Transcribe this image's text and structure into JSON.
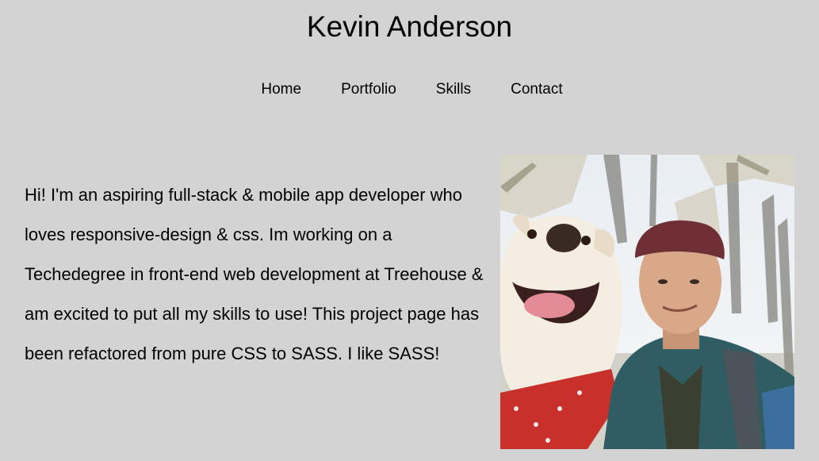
{
  "header": {
    "title": "Kevin Anderson"
  },
  "nav": {
    "items": [
      {
        "label": "Home"
      },
      {
        "label": "Portfolio"
      },
      {
        "label": "Skills"
      },
      {
        "label": "Contact"
      }
    ]
  },
  "main": {
    "intro": "Hi! I'm an aspiring full-stack & mobile app developer who loves responsive-design & css. Im working on a Techedegree in front-end web development at Treehouse & am excited to put all my skills to use! This project page has been refactored from pure CSS to SASS. I like SASS!",
    "photo_icon": "profile-photo"
  },
  "colors": {
    "background": "#d3d3d3",
    "text": "#000000"
  }
}
